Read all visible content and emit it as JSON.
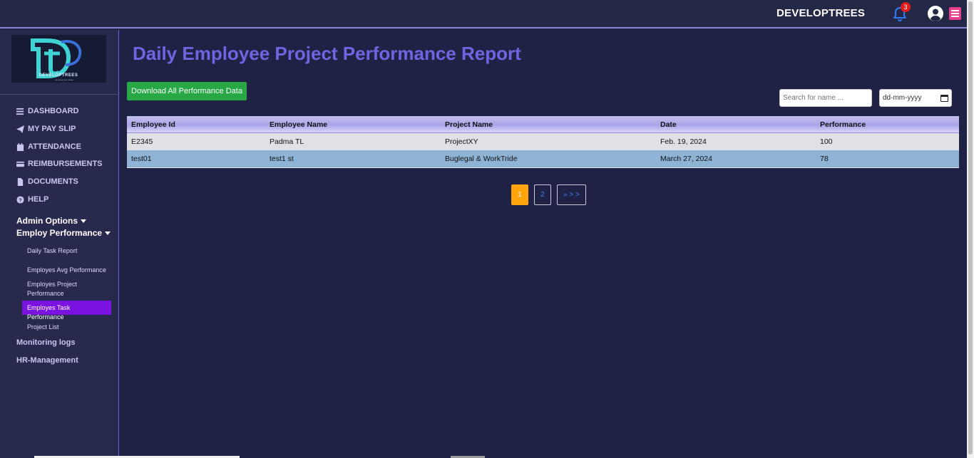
{
  "header": {
    "brand": "DEVELOPTREES",
    "notification_count": "3",
    "icons": {
      "notification": "bell-icon",
      "profile": "user-circle-icon",
      "menu": "hamburger-icon"
    }
  },
  "sidebar": {
    "logo_text": "DEVELOPTREES",
    "nav": [
      {
        "label": "DASHBOARD",
        "icon": "bars-icon"
      },
      {
        "label": "MY PAY SLIP",
        "icon": "paper-plane-icon"
      },
      {
        "label": "ATTENDANCE",
        "icon": "calendar-icon"
      },
      {
        "label": "REIMBURSEMENTS",
        "icon": "credit-card-icon"
      },
      {
        "label": "DOCUMENTS",
        "icon": "file-icon"
      },
      {
        "label": "HELP",
        "icon": "question-circle-icon"
      }
    ],
    "admin_options": "Admin Options",
    "employ_performance": "Employ Performance",
    "sub_items": [
      "Daily Task Report",
      "Employes Avg Performance",
      "Employes Project Performance",
      "Employes Task Performance",
      "Project List"
    ],
    "monitoring_logs": "Monitoring logs",
    "hr_management": "HR-Management"
  },
  "main": {
    "title": "Daily Employee Project Performance Report",
    "download_button": "Download All Performance Data",
    "search_placeholder": "Search for name ...",
    "date_placeholder": "dd-mm-yyyy",
    "table": {
      "headers": [
        "Employee Id",
        "Employee Name",
        "Project Name",
        "Date",
        "Performance"
      ],
      "rows": [
        [
          "E2345",
          "Padma TL",
          "ProjectXY",
          "Feb. 19, 2024",
          "100"
        ],
        [
          "test01",
          "test1 st",
          "Buglegal & WorkTride",
          "March 27, 2024",
          "78"
        ]
      ]
    },
    "pagination": {
      "pages": [
        "1",
        "2"
      ],
      "next": "» > >",
      "current": "1"
    }
  },
  "colors": {
    "background": "#1f2244",
    "sidebar": "#272a4d",
    "title": "#7065e0",
    "download": "#28a745",
    "active_page": "#ffa40a",
    "active_sub": "#7a12e0",
    "menu_button": "#e83e8c"
  }
}
